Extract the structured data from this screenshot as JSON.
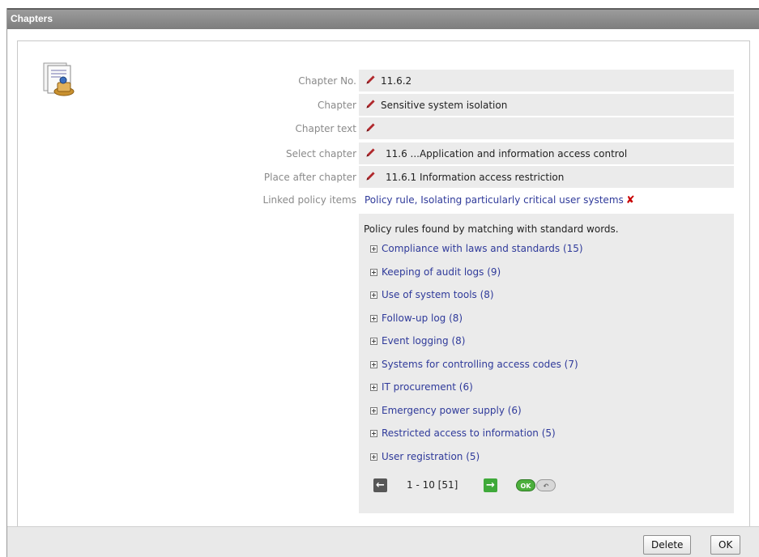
{
  "window": {
    "title": "Chapters"
  },
  "form": {
    "chapter_no": {
      "label": "Chapter No.",
      "value": "11.6.2"
    },
    "chapter": {
      "label": "Chapter",
      "value": "Sensitive system isolation"
    },
    "chapter_text": {
      "label": "Chapter text",
      "value": ""
    },
    "select_chapter": {
      "label": "Select chapter",
      "value": "11.6 ...Application and information access control"
    },
    "place_after": {
      "label": "Place after chapter",
      "value": "11.6.1 Information access restriction"
    },
    "linked": {
      "label": "Linked policy items",
      "value": "Policy rule, Isolating particularly critical user systems"
    }
  },
  "policy": {
    "heading": "Policy rules found by matching with standard words.",
    "items": [
      "Compliance with laws and standards (15)",
      "Keeping of audit logs (9)",
      "Use of system tools (8)",
      "Follow-up log (8)",
      "Event logging (8)",
      "Systems for controlling access codes (7)",
      "IT procurement (6)",
      "Emergency power supply (6)",
      "Restricted access to information (5)",
      "User registration (5)"
    ],
    "pager": {
      "text": "1 - 10 [51]",
      "ok_label": "OK",
      "undo_label": "↶"
    }
  },
  "footer": {
    "delete_label": "Delete",
    "ok_label": "OK"
  },
  "icons": {
    "pencil": "pencil-icon",
    "remove": "remove-x-icon",
    "expand": "expand-plus-icon",
    "prev": "arrow-left-icon",
    "next": "arrow-right-icon",
    "document": "document-icon"
  },
  "colors": {
    "link": "#2f3a9a",
    "pencil": "#b0282c",
    "remove": "#c80000",
    "next_button": "#3fa93a",
    "title_bar": "#8c8c8c",
    "field_bg": "#ebebeb"
  }
}
